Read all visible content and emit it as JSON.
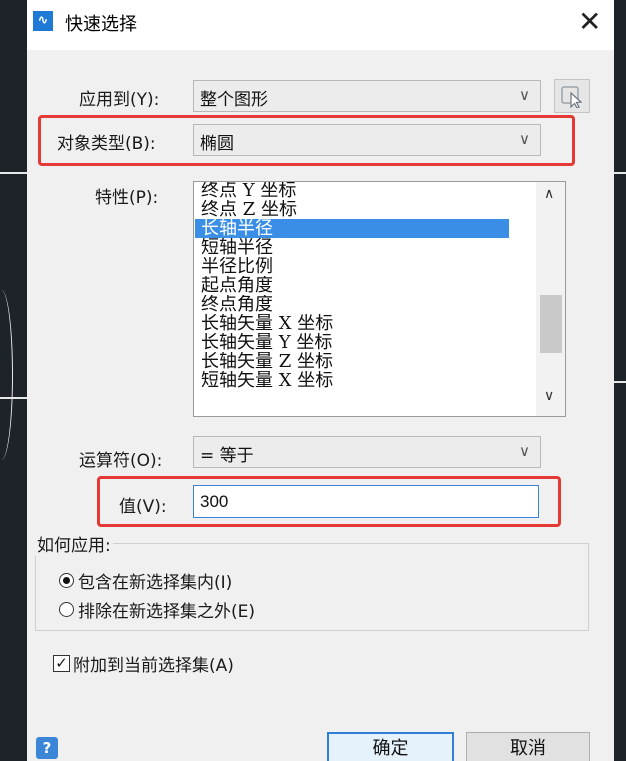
{
  "dialog": {
    "title": "快速选择",
    "close_glyph": "✕"
  },
  "apply_to": {
    "label": "应用到(Y):",
    "value": "整个图形"
  },
  "object_type": {
    "label": "对象类型(B):",
    "value": "椭圆"
  },
  "properties": {
    "label": "特性(P):",
    "items": [
      "终点 Y 坐标",
      "终点 Z 坐标",
      "长轴半径",
      "短轴半径",
      "半径比例",
      "起点角度",
      "终点角度",
      "长轴矢量 X 坐标",
      "长轴矢量 Y 坐标",
      "长轴矢量 Z 坐标",
      "短轴矢量 X 坐标"
    ],
    "selected": "长轴半径"
  },
  "operator": {
    "label": "运算符(O):",
    "value": "= 等于"
  },
  "value_field": {
    "label": "值(V):",
    "value": "300"
  },
  "how_to_apply": {
    "title": "如何应用:",
    "include_label": "包含在新选择集内(I)",
    "exclude_label": "排除在新选择集之外(E)",
    "selected": "include"
  },
  "append": {
    "label": "附加到当前选择集(A)",
    "checked": true
  },
  "buttons": {
    "help": "?",
    "ok": "确定",
    "cancel": "取消"
  },
  "colors": {
    "accent": "#3a8ee6",
    "highlight": "#e53935"
  }
}
